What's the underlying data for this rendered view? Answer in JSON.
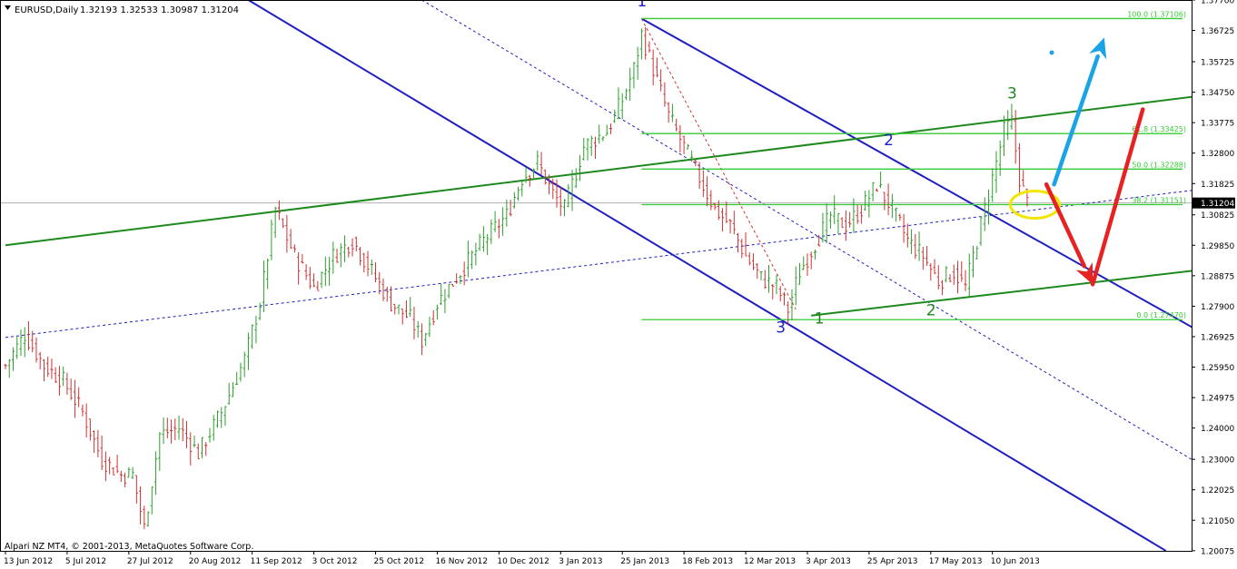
{
  "header": {
    "symbol": "EURUSD,Daily",
    "ohlc": "1.32193 1.32533 1.30987 1.31204"
  },
  "footer": {
    "copyright": "Alpari NZ MT4, © 2001-2013, MetaQuotes Software Corp."
  },
  "colors": {
    "bull": "#2e9e2e",
    "bear": "#cc3333",
    "fib": "#33cc33",
    "channel_blue": "#1f1fc0",
    "channel_green": "#1e8a1e",
    "arrow_blue": "#1aa3e6",
    "arrow_red": "#e62222",
    "highlight": "#f2e600",
    "current_price_box": "#000000"
  },
  "chart_data": {
    "type": "candlestick",
    "symbol": "EURUSD",
    "timeframe": "Daily",
    "ylim": [
      1.2007,
      1.377
    ],
    "current_price": 1.31204,
    "y_ticks": [
      "1.37700",
      "1.36725",
      "1.35725",
      "1.34750",
      "1.33775",
      "1.32800",
      "1.31825",
      "1.30825",
      "1.29850",
      "1.28875",
      "1.27900",
      "1.26925",
      "1.25950",
      "1.24975",
      "1.24000",
      "1.23000",
      "1.22025",
      "1.21050",
      "1.20075"
    ],
    "y_tick_values": [
      1.377,
      1.36725,
      1.35725,
      1.3475,
      1.33775,
      1.328,
      1.31825,
      1.30825,
      1.2985,
      1.28875,
      1.279,
      1.26925,
      1.2595,
      1.24975,
      1.24,
      1.23,
      1.22025,
      1.2105,
      1.20075
    ],
    "x_ticks": [
      "13 Jun 2012",
      "5 Jul 2012",
      "27 Jul 2012",
      "20 Aug 2012",
      "11 Sep 2012",
      "3 Oct 2012",
      "25 Oct 2012",
      "16 Nov 2012",
      "10 Dec 2012",
      "3 Jan 2013",
      "25 Jan 2013",
      "18 Feb 2013",
      "12 Mar 2013",
      "3 Apr 2013",
      "25 Apr 2013",
      "17 May 2013",
      "10 Jun 2013"
    ],
    "x_tick_index": [
      0,
      16,
      32,
      48,
      64,
      80,
      96,
      112,
      128,
      144,
      160,
      176,
      192,
      208,
      224,
      240,
      256
    ],
    "price_path": [
      [
        0,
        1.26
      ],
      [
        5,
        1.27
      ],
      [
        10,
        1.26
      ],
      [
        15,
        1.255
      ],
      [
        20,
        1.245
      ],
      [
        25,
        1.23
      ],
      [
        30,
        1.225
      ],
      [
        33,
        1.225
      ],
      [
        36,
        1.208
      ],
      [
        40,
        1.238
      ],
      [
        45,
        1.24
      ],
      [
        50,
        1.232
      ],
      [
        56,
        1.245
      ],
      [
        62,
        1.262
      ],
      [
        66,
        1.28
      ],
      [
        70,
        1.31
      ],
      [
        75,
        1.295
      ],
      [
        80,
        1.285
      ],
      [
        85,
        1.295
      ],
      [
        90,
        1.3
      ],
      [
        95,
        1.29
      ],
      [
        100,
        1.28
      ],
      [
        105,
        1.275
      ],
      [
        108,
        1.268
      ],
      [
        112,
        1.28
      ],
      [
        118,
        1.29
      ],
      [
        124,
        1.3
      ],
      [
        130,
        1.308
      ],
      [
        134,
        1.32
      ],
      [
        138,
        1.325
      ],
      [
        142,
        1.315
      ],
      [
        145,
        1.31
      ],
      [
        150,
        1.33
      ],
      [
        156,
        1.335
      ],
      [
        160,
        1.345
      ],
      [
        163,
        1.355
      ],
      [
        165,
        1.366
      ],
      [
        168,
        1.355
      ],
      [
        172,
        1.34
      ],
      [
        176,
        1.33
      ],
      [
        180,
        1.32
      ],
      [
        184,
        1.31
      ],
      [
        188,
        1.305
      ],
      [
        192,
        1.295
      ],
      [
        196,
        1.288
      ],
      [
        200,
        1.285
      ],
      [
        203,
        1.278
      ],
      [
        206,
        1.29
      ],
      [
        210,
        1.299
      ],
      [
        214,
        1.308
      ],
      [
        218,
        1.305
      ],
      [
        222,
        1.31
      ],
      [
        226,
        1.318
      ],
      [
        230,
        1.31
      ],
      [
        234,
        1.3
      ],
      [
        238,
        1.295
      ],
      [
        242,
        1.287
      ],
      [
        246,
        1.29
      ],
      [
        249,
        1.285
      ],
      [
        252,
        1.3
      ],
      [
        256,
        1.32
      ],
      [
        259,
        1.335
      ],
      [
        261,
        1.338
      ],
      [
        263,
        1.32
      ],
      [
        265,
        1.312
      ]
    ],
    "fib_levels": [
      {
        "label": "100.0 (1.37106)",
        "price": 1.37106
      },
      {
        "label": "61.8 (1.33425)",
        "price": 1.33425
      },
      {
        "label": "50.0 (1.32288)",
        "price": 1.32288
      },
      {
        "label": "38.2 (1.31151)",
        "price": 1.31151
      },
      {
        "label": "0.0 (1.27470)",
        "price": 1.2747
      }
    ],
    "wave_labels": [
      {
        "text": "1",
        "index": 165,
        "price": 1.3749,
        "color": "#1f1fc0"
      },
      {
        "text": "2",
        "index": 229,
        "price": 1.3305,
        "color": "#1f1fc0"
      },
      {
        "text": "3",
        "index": 201,
        "price": 1.2705,
        "color": "#1f1fc0"
      },
      {
        "text": "1",
        "index": 211,
        "price": 1.2735,
        "color": "#1e8a1e"
      },
      {
        "text": "2",
        "index": 240,
        "price": 1.276,
        "color": "#1e8a1e"
      },
      {
        "text": "3",
        "index": 261,
        "price": 1.3455,
        "color": "#1e8a1e"
      }
    ],
    "blue_channel": [
      {
        "from": [
          63,
          1.377
        ],
        "to": [
          301,
          1.2007
        ]
      },
      {
        "from": [
          165,
          1.37106
        ],
        "to": [
          340,
          1.25
        ]
      },
      {
        "from": [
          0,
          1.298
        ],
        "to": [
          340,
          1.451
        ],
        "style": "dotted-parallel"
      }
    ],
    "blue_dotted": [
      {
        "from": [
          108,
          1.377
        ],
        "to": [
          328,
          1.215
        ]
      },
      {
        "from": [
          0,
          1.269
        ],
        "to": [
          340,
          1.321
        ]
      }
    ],
    "green_channel": [
      {
        "from": [
          0,
          1.2985
        ],
        "to": [
          340,
          1.351
        ]
      },
      {
        "from": [
          209,
          1.276
        ],
        "to": [
          340,
          1.295
        ]
      }
    ],
    "red_dotted": {
      "from": [
        165,
        1.371
      ],
      "to": [
        205,
        1.278
      ]
    },
    "arrows": [
      {
        "color": "blue",
        "from": [
          272,
          1.318
        ],
        "to": [
          285,
          1.365
        ]
      },
      {
        "color": "red",
        "from": [
          270,
          1.318
        ],
        "to": [
          282,
          1.286
        ]
      },
      {
        "color": "red",
        "from": [
          282,
          1.286
        ],
        "to": [
          295,
          1.342
        ]
      }
    ],
    "highlight_ellipse": {
      "index": 267,
      "price": 1.3115
    }
  }
}
